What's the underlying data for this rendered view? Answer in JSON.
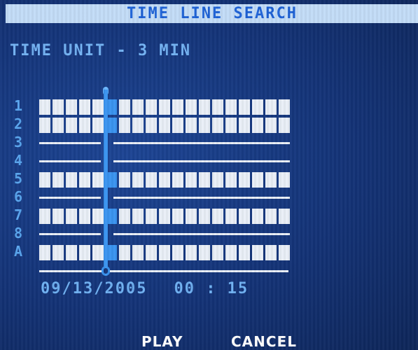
{
  "title": "TIME LINE SEARCH",
  "time_unit": "TIME UNIT - 3 MIN",
  "channels": [
    "1",
    "2",
    "3",
    "4",
    "5",
    "6",
    "7",
    "8",
    "A"
  ],
  "date": "09/13/2005",
  "time": "00 : 15",
  "buttons": {
    "play": "PLAY",
    "cancel": "CANCEL"
  },
  "colors": {
    "background": "#143377",
    "title_bar": "#c3dcf7",
    "accent": "#3a94f0",
    "text": "#74b3f3"
  }
}
